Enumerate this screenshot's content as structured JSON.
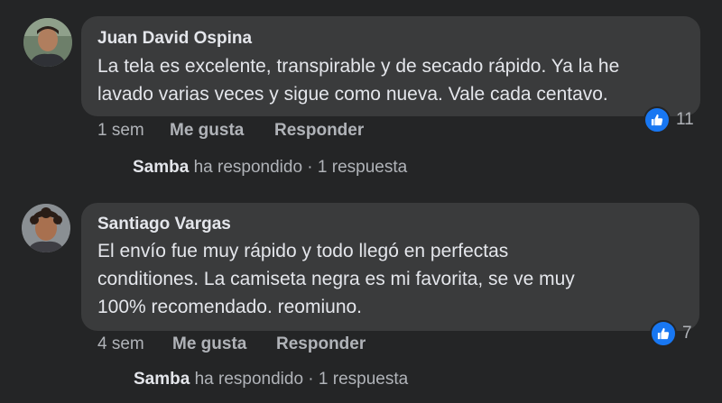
{
  "colors": {
    "background": "#242526",
    "bubble": "#3a3b3c",
    "like_blue": "#1877f2",
    "text_primary": "#e4e6eb",
    "text_secondary": "#b0b3b8"
  },
  "comments": [
    {
      "author": "Juan David Ospina",
      "lines": [
        "La tela es excelente, transpirable y de secado rápido. Ya la he",
        "lavado varias veces y sigue como nueva. Vale cada centavo."
      ],
      "time": "1 sem",
      "like_label": "Me gusta",
      "reply_label": "Responder",
      "reaction_icon": "thumbs-up-icon",
      "reaction_count": "11",
      "reply_author": "Samba",
      "reply_text": " ha respondido · 1 respuesta"
    },
    {
      "author": "Santiago Vargas",
      "lines": [
        "El envío fue muy rápido y todo llegó en perfectas",
        "conditiones. La camiseta negra es mi favorita, se ve muy",
        "100% recomendado. reomiuno."
      ],
      "time": "4 sem",
      "like_label": "Me gusta",
      "reply_label": "Responder",
      "reaction_icon": "thumbs-up-icon",
      "reaction_count": "7",
      "reply_author": "Samba",
      "reply_text": " ha respondido · 1 respuesta"
    }
  ]
}
